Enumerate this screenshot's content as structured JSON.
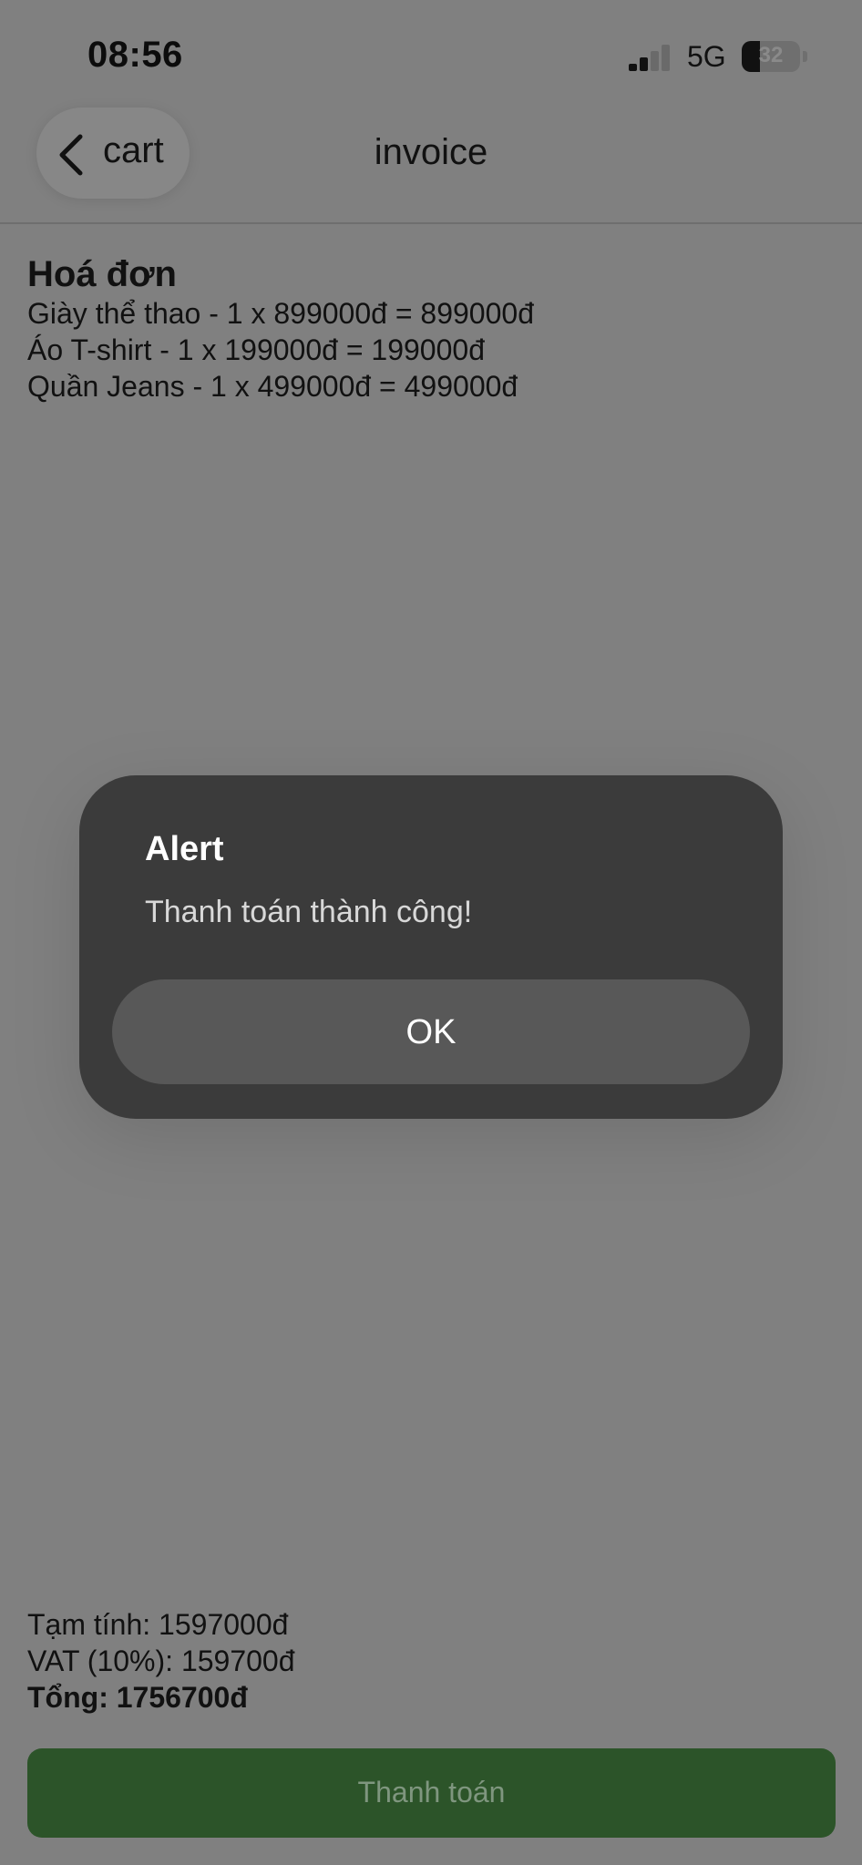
{
  "status_bar": {
    "time": "08:56",
    "network": "5G",
    "battery_percent": "32",
    "battery_level": 0.32,
    "signal_bars_active": 2,
    "signal_bars_total": 4
  },
  "nav": {
    "back_label": "cart",
    "title": "invoice"
  },
  "invoice": {
    "title": "Hoá đơn",
    "items": [
      "Giày thể thao - 1 x 899000đ = 899000đ",
      "Áo T-shirt - 1 x 199000đ = 199000đ",
      "Quần Jeans - 1 x 499000đ = 499000đ"
    ]
  },
  "summary": {
    "subtotal": "Tạm tính: 1597000đ",
    "vat": "VAT (10%): 159700đ",
    "total": "Tổng: 1756700đ"
  },
  "pay_button": {
    "label": "Thanh toán"
  },
  "alert": {
    "title": "Alert",
    "message": "Thanh toán thành công!",
    "ok_label": "OK"
  },
  "colors": {
    "overlay_background": "#808080",
    "alert_background": "#3b3b3b",
    "alert_button": "#585858",
    "pay_button": "#2c5429"
  },
  "icons": {
    "back": "chevron-left-icon",
    "signal": "cellular-signal-icon",
    "battery": "battery-icon"
  }
}
